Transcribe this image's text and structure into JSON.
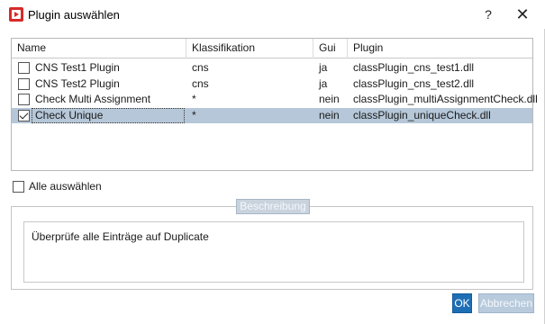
{
  "window": {
    "title": "Plugin auswählen",
    "help_label": "?",
    "close_label": "✕"
  },
  "table": {
    "columns": [
      "Name",
      "Klassifikation",
      "Gui",
      "Plugin"
    ],
    "rows": [
      {
        "checked": false,
        "selected": false,
        "name": "CNS Test1 Plugin",
        "klassifikation": "cns",
        "gui": "ja",
        "plugin": "classPlugin_cns_test1.dll"
      },
      {
        "checked": false,
        "selected": false,
        "name": "CNS Test2 Plugin",
        "klassifikation": "cns",
        "gui": "ja",
        "plugin": "classPlugin_cns_test2.dll"
      },
      {
        "checked": false,
        "selected": false,
        "name": "Check Multi Assignment",
        "klassifikation": "*",
        "gui": "nein",
        "plugin": "classPlugin_multiAssignmentCheck.dll"
      },
      {
        "checked": true,
        "selected": true,
        "name": "Check Unique",
        "klassifikation": "*",
        "gui": "nein",
        "plugin": "classPlugin_uniqueCheck.dll"
      }
    ]
  },
  "select_all": {
    "label": "Alle auswählen",
    "checked": false
  },
  "description": {
    "group_title": "Beschreibung",
    "text": "Überprüfe alle Einträge auf Duplicate"
  },
  "buttons": {
    "ok": "OK",
    "cancel": "Abbrechen"
  },
  "colors": {
    "selection": "#b5c7d8",
    "ok_button": "#1e6eb5",
    "app_icon": "#d62b2b"
  }
}
